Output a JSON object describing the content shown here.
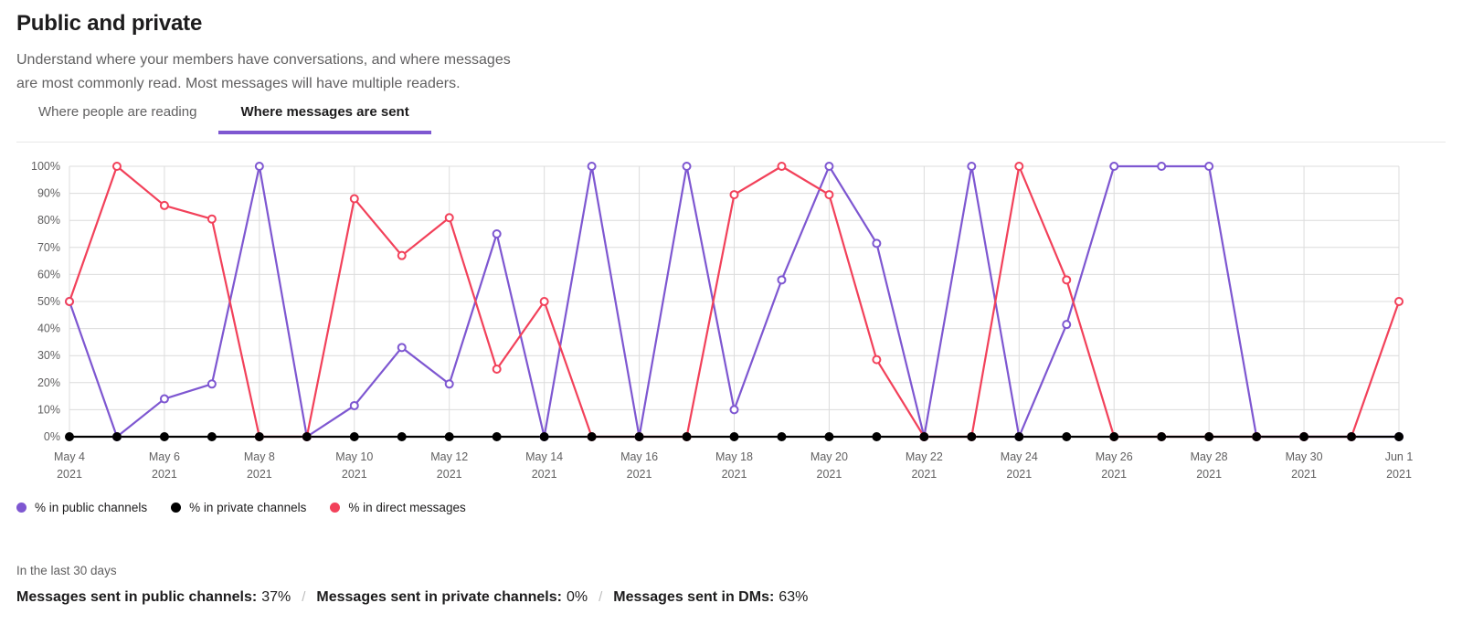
{
  "header": {
    "title": "Public and private",
    "subtitle_line1": "Understand where your members have conversations, and where messages",
    "subtitle_line2": "are most commonly read. Most messages will have multiple readers."
  },
  "tabs": [
    {
      "label": "Where people are reading",
      "active": false
    },
    {
      "label": "Where messages are sent",
      "active": true
    }
  ],
  "legend": [
    {
      "label": "% in public channels",
      "color": "#7e57d1"
    },
    {
      "label": "% in private channels",
      "color": "#000000"
    },
    {
      "label": "% in direct messages",
      "color": "#f2415a"
    }
  ],
  "footer": {
    "note": "In the last 30 days",
    "stats": [
      {
        "label": "Messages sent in public channels:",
        "value": "37%"
      },
      {
        "label": "Messages sent in private channels:",
        "value": "0%"
      },
      {
        "label": "Messages sent in DMs:",
        "value": "63%"
      }
    ],
    "separator": "/"
  },
  "colors": {
    "accent": "#7e57d1",
    "public": "#7e57d1",
    "private": "#000000",
    "dm": "#f2415a",
    "grid": "#dcdcdc",
    "text": "#1d1c1d",
    "muted": "#616061"
  },
  "chart_data": {
    "type": "line",
    "title": "",
    "xlabel": "",
    "ylabel": "",
    "ylim": [
      0,
      100
    ],
    "yticks": [
      "0%",
      "10%",
      "20%",
      "30%",
      "40%",
      "50%",
      "60%",
      "70%",
      "80%",
      "90%",
      "100%"
    ],
    "ytick_values": [
      0,
      10,
      20,
      30,
      40,
      50,
      60,
      70,
      80,
      90,
      100
    ],
    "grid": true,
    "legend_position": "bottom-left",
    "x": [
      "May 4 2021",
      "May 5 2021",
      "May 6 2021",
      "May 7 2021",
      "May 8 2021",
      "May 9 2021",
      "May 10 2021",
      "May 11 2021",
      "May 12 2021",
      "May 13 2021",
      "May 14 2021",
      "May 15 2021",
      "May 16 2021",
      "May 17 2021",
      "May 18 2021",
      "May 19 2021",
      "May 20 2021",
      "May 21 2021",
      "May 22 2021",
      "May 23 2021",
      "May 24 2021",
      "May 25 2021",
      "May 26 2021",
      "May 27 2021",
      "May 28 2021",
      "May 29 2021",
      "May 30 2021",
      "May 31 2021",
      "Jun 1 2021"
    ],
    "xtick_labels": [
      {
        "index": 0,
        "line1": "May 4",
        "line2": "2021"
      },
      {
        "index": 2,
        "line1": "May 6",
        "line2": "2021"
      },
      {
        "index": 4,
        "line1": "May 8",
        "line2": "2021"
      },
      {
        "index": 6,
        "line1": "May 10",
        "line2": "2021"
      },
      {
        "index": 8,
        "line1": "May 12",
        "line2": "2021"
      },
      {
        "index": 10,
        "line1": "May 14",
        "line2": "2021"
      },
      {
        "index": 12,
        "line1": "May 16",
        "line2": "2021"
      },
      {
        "index": 14,
        "line1": "May 18",
        "line2": "2021"
      },
      {
        "index": 16,
        "line1": "May 20",
        "line2": "2021"
      },
      {
        "index": 18,
        "line1": "May 22",
        "line2": "2021"
      },
      {
        "index": 20,
        "line1": "May 24",
        "line2": "2021"
      },
      {
        "index": 22,
        "line1": "May 26",
        "line2": "2021"
      },
      {
        "index": 24,
        "line1": "May 28",
        "line2": "2021"
      },
      {
        "index": 26,
        "line1": "May 30",
        "line2": "2021"
      },
      {
        "index": 28,
        "line1": "Jun 1",
        "line2": "2021"
      }
    ],
    "series": [
      {
        "name": "% in public channels",
        "color": "#7e57d1",
        "values": [
          50,
          0,
          14,
          19.5,
          100,
          0,
          11.5,
          33,
          19.5,
          75,
          0,
          100,
          0,
          100,
          10,
          58,
          100,
          71.5,
          0,
          100,
          0,
          41.5,
          100,
          100,
          100,
          0,
          0,
          0,
          0
        ]
      },
      {
        "name": "% in private channels",
        "color": "#000000",
        "values": [
          0,
          0,
          0,
          0,
          0,
          0,
          0,
          0,
          0,
          0,
          0,
          0,
          0,
          0,
          0,
          0,
          0,
          0,
          0,
          0,
          0,
          0,
          0,
          0,
          0,
          0,
          0,
          0,
          0
        ]
      },
      {
        "name": "% in direct messages",
        "color": "#f2415a",
        "values": [
          50,
          100,
          85.5,
          80.5,
          0,
          0,
          88,
          67,
          81,
          25,
          50,
          0,
          0,
          0,
          89.5,
          100,
          89.5,
          28.5,
          0,
          0,
          100,
          58,
          0,
          0,
          0,
          0,
          0,
          0,
          50
        ]
      }
    ]
  }
}
